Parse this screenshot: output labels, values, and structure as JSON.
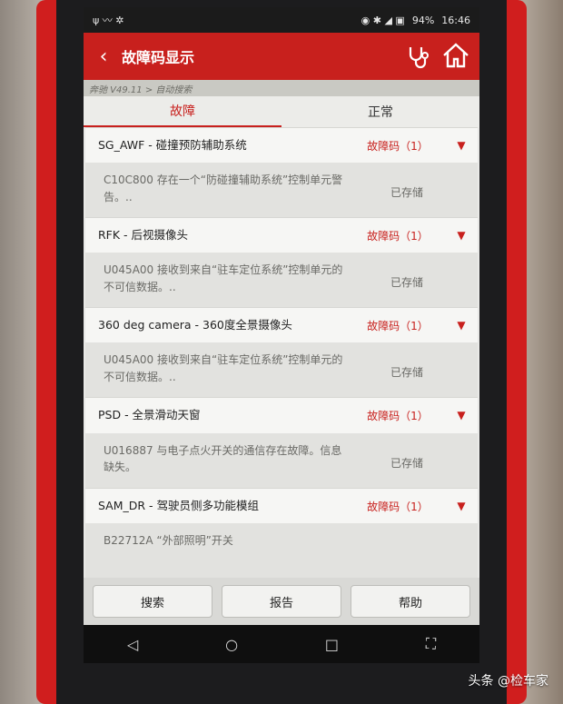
{
  "statusbar": {
    "left_icons": "ψ 〰 ✲",
    "right_icons": "◉ ✱ ◢ ▣",
    "battery": "94%",
    "time": "16:46"
  },
  "header": {
    "title": "故障码显示",
    "back": "‹"
  },
  "breadcrumb": "奔驰 V49.11 > 自动搜索",
  "tabs": [
    {
      "label": "故障"
    },
    {
      "label": "正常"
    }
  ],
  "modules": [
    {
      "name": "SG_AWF - 碰撞预防辅助系统",
      "code": "故障码（1）",
      "desc": "C10C800 存在一个“防碰撞辅助系统”控制单元警告。..",
      "state": "已存储"
    },
    {
      "name": "RFK - 后视摄像头",
      "code": "故障码（1）",
      "desc": "U045A00 接收到来自“驻车定位系统”控制单元的不可信数据。..",
      "state": "已存储"
    },
    {
      "name": "360 deg camera - 360度全景摄像头",
      "code": "故障码（1）",
      "desc": "U045A00 接收到来自“驻车定位系统”控制单元的不可信数据。..",
      "state": "已存储"
    },
    {
      "name": "PSD - 全景滑动天窗",
      "code": "故障码（1）",
      "desc": "U016887 与电子点火开关的通信存在故障。信息缺失。",
      "state": "已存储"
    },
    {
      "name": "SAM_DR - 驾驶员侧多功能模组",
      "code": "故障码（1）",
      "desc": "B22712A “外部照明”开关",
      "state": ""
    }
  ],
  "buttons": {
    "search": "搜索",
    "report": "报告",
    "help": "帮助"
  },
  "navbar": {
    "back": "◁",
    "home": "○",
    "recent": "□",
    "screenshot": "⛶"
  },
  "watermark": "头条 @检车家",
  "colors": {
    "accent": "#c8201d",
    "status_bar": "#1b1b1b"
  }
}
